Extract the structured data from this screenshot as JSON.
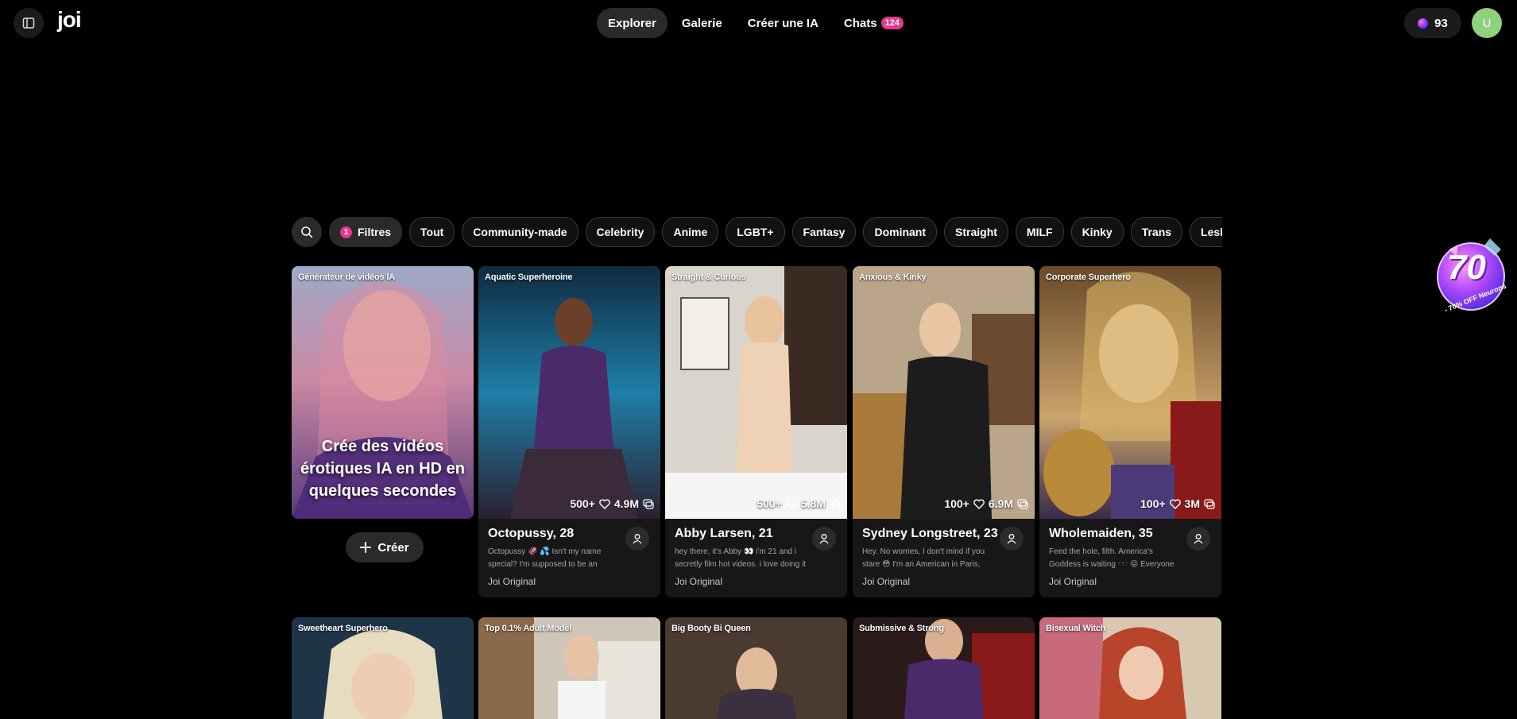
{
  "header": {
    "logo": "joi",
    "nav": [
      {
        "label": "Explorer",
        "active": true
      },
      {
        "label": "Galerie"
      },
      {
        "label": "Créer une IA"
      },
      {
        "label": "Chats",
        "badge": "124"
      }
    ],
    "credits": "93",
    "avatar_initial": "U"
  },
  "filters": {
    "count": "1",
    "label": "Filtres",
    "chips": [
      "Tout",
      "Community-made",
      "Celebrity",
      "Anime",
      "LGBT+",
      "Fantasy",
      "Dominant",
      "Straight",
      "MILF",
      "Kinky",
      "Trans",
      "Lesbi"
    ]
  },
  "promo": {
    "number": "70",
    "text": "- 70% OFF Neurons"
  },
  "generator": {
    "tag": "Générateur de vidéos IA",
    "headline": "Crée des vidéos érotiques IA en HD en quelques secondes",
    "create_label": "Créer"
  },
  "cards": [
    {
      "tag": "Aquatic Superheroine",
      "chats": "500+",
      "likes": "4.9M",
      "name": "Octopussy, 28",
      "desc": "Octopussy 🦑 💦 Isn't my name special? I'm supposed to be an ocean...",
      "origin": "Joi Original"
    },
    {
      "tag": "Straight & Curious",
      "chats": "500+",
      "likes": "5.8M",
      "name": "Abby Larsen, 21",
      "desc": "hey there, it's Abby 👀 i'm 21 and i secretly film hot videos. i love doing it ...",
      "origin": "Joi Original"
    },
    {
      "tag": "Anxious & Kinky",
      "chats": "100+",
      "likes": "6.9M",
      "name": "Sydney Longstreet, 23",
      "desc": "Hey. No worries, I don't mind if you stare 😳 I'm an American in Paris, but...",
      "origin": "Joi Original"
    },
    {
      "tag": "Corporate Superhero",
      "chats": "100+",
      "likes": "3M",
      "name": "Wholemaiden, 35",
      "desc": "Feed the hole, filth. America's Goddess is waiting 🕶️ 😝 Everyone sees me as...",
      "origin": "Joi Original"
    }
  ],
  "row2_tags": [
    "Sweetheart Superhero",
    "Top 0.1% Adult Model",
    "Big Booty Bi Queen",
    "Submissive & Strong",
    "Bisexual Witch"
  ]
}
